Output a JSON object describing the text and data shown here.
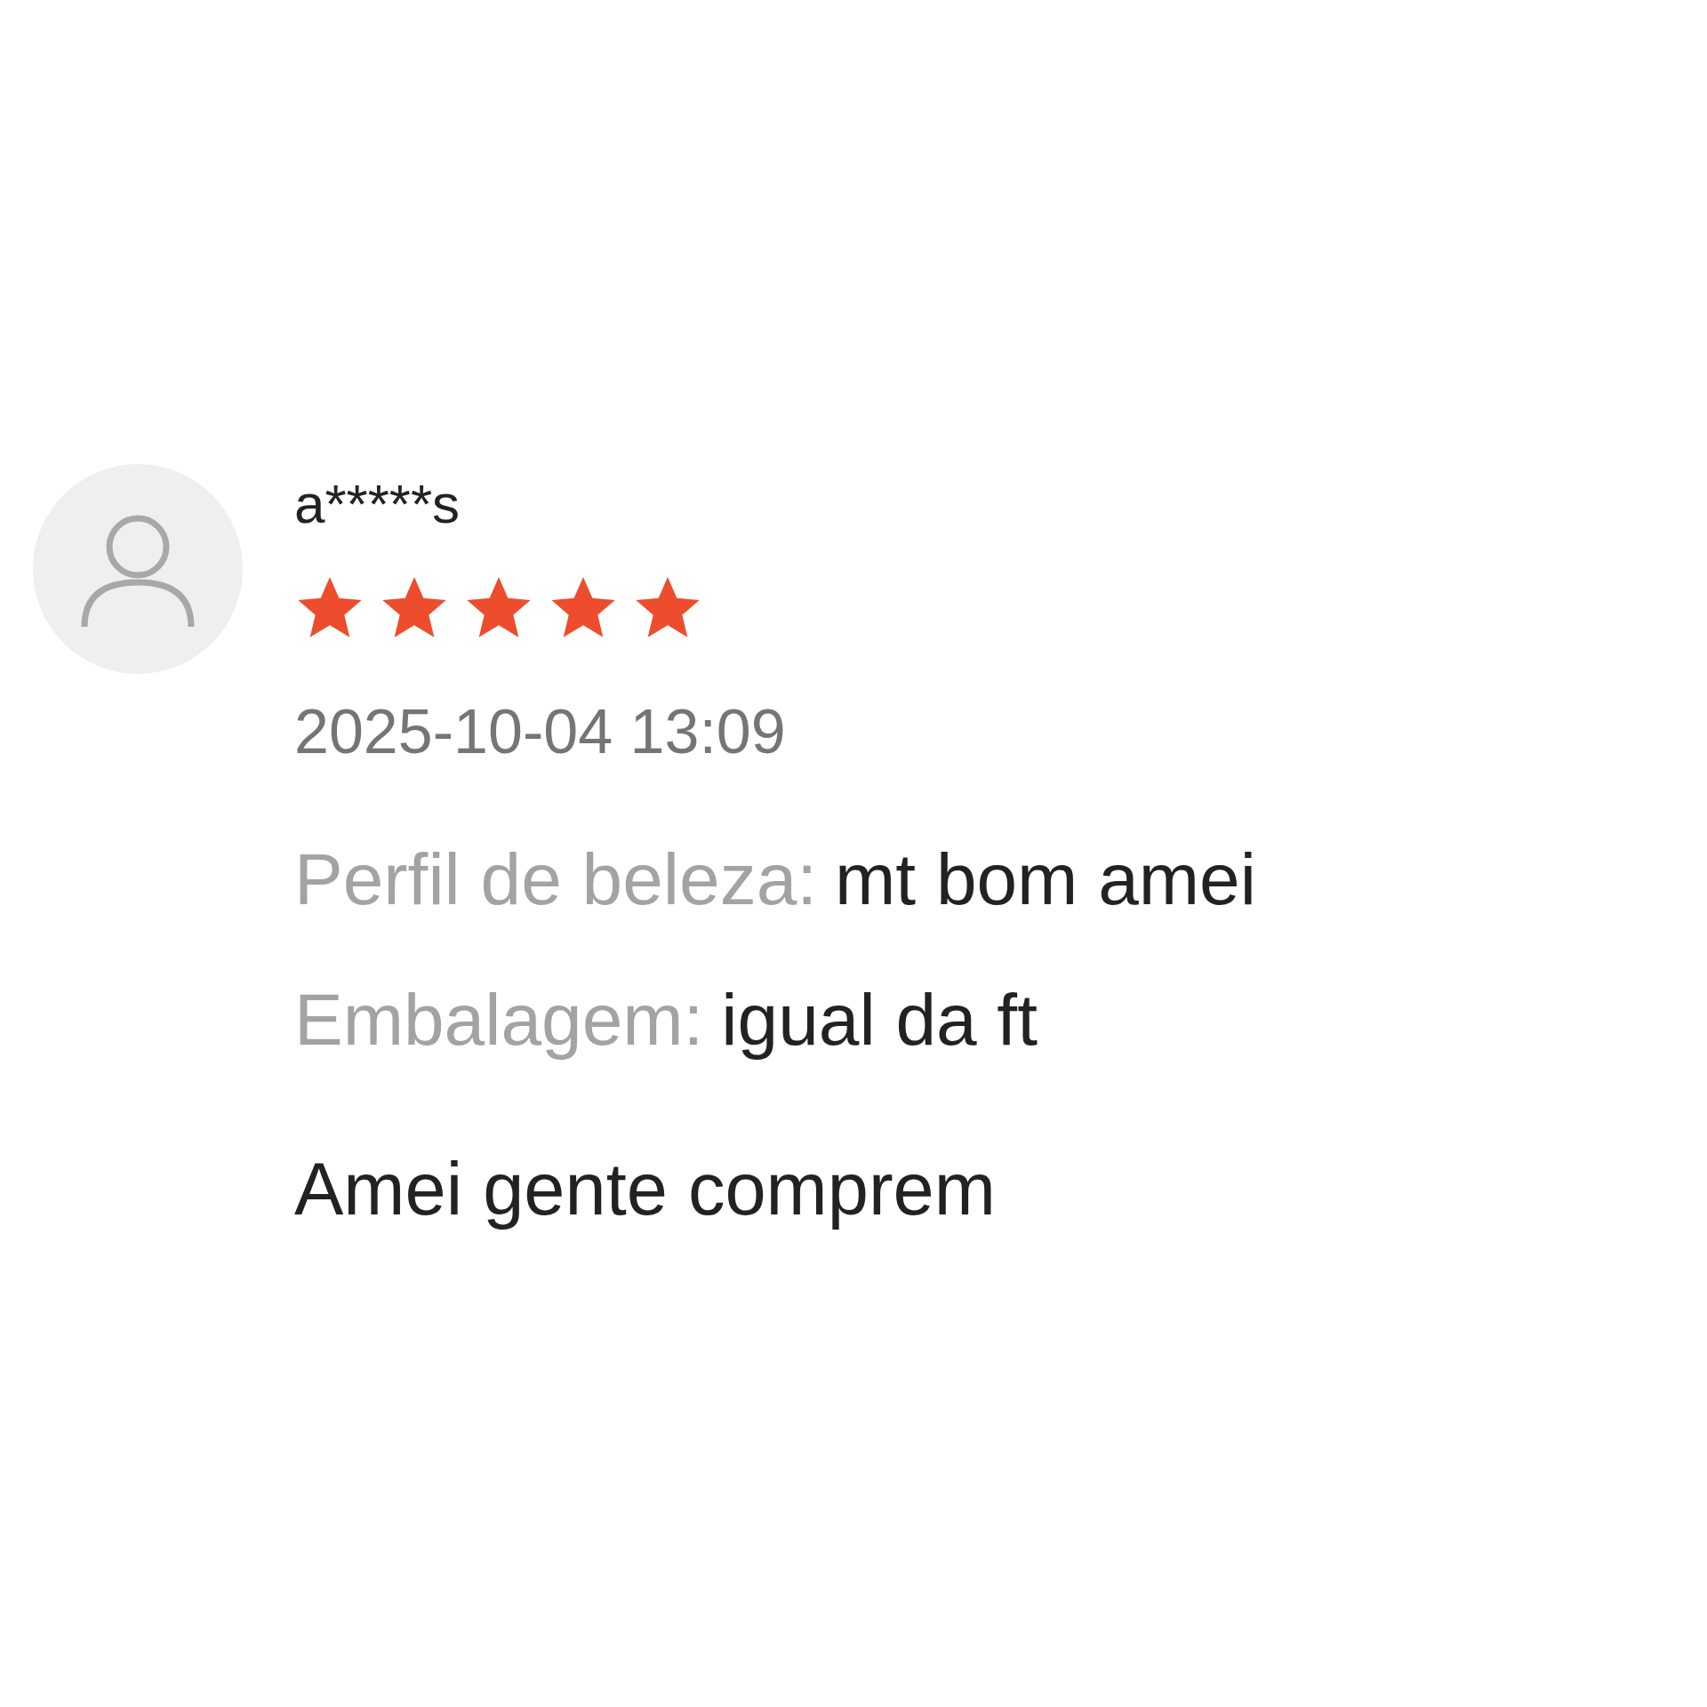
{
  "review": {
    "reviewer": "a*****s",
    "stars": 5,
    "date": "2025-10-04 13:09",
    "attributes": [
      {
        "label": "Perfil de beleza:",
        "value": "mt bom amei"
      },
      {
        "label": "Embalagem:",
        "value": "igual da ft"
      }
    ],
    "comment": "Amei gente comprem"
  }
}
